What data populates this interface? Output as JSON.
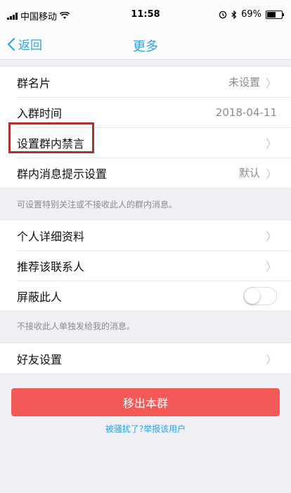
{
  "status_bar": {
    "carrier": "中国移动",
    "time": "11:58",
    "battery_percent": "69%",
    "battery_level": 0.69,
    "icons": [
      "signal-icon",
      "wifi-icon",
      "alarm-icon",
      "bluetooth-icon",
      "battery-icon"
    ]
  },
  "nav": {
    "back_label": "返回",
    "title": "更多"
  },
  "group1": [
    {
      "label": "群名片",
      "value": "未设置",
      "chevron": true
    },
    {
      "label": "入群时间",
      "value": "2018-04-11",
      "chevron": false
    },
    {
      "label": "设置群内禁言",
      "value": "",
      "chevron": true
    },
    {
      "label": "群内消息提示设置",
      "value": "默认",
      "chevron": true
    }
  ],
  "note1": "可设置特别关注或不接收此人的群内消息。",
  "group2": [
    {
      "label": "个人详细资料",
      "chevron": true
    },
    {
      "label": "推荐该联系人",
      "chevron": true
    },
    {
      "label": "屏蔽此人",
      "toggle": false
    }
  ],
  "note2": "不接收此人单独发给我的消息。",
  "group3": [
    {
      "label": "好友设置",
      "chevron": true
    }
  ],
  "remove_button": "移出本群",
  "report_link": "被骚扰了?举报该用户",
  "colors": {
    "accent": "#2aa4e8",
    "danger": "#f35a57",
    "highlight_box": "#b0302e",
    "background": "#efeff4"
  }
}
